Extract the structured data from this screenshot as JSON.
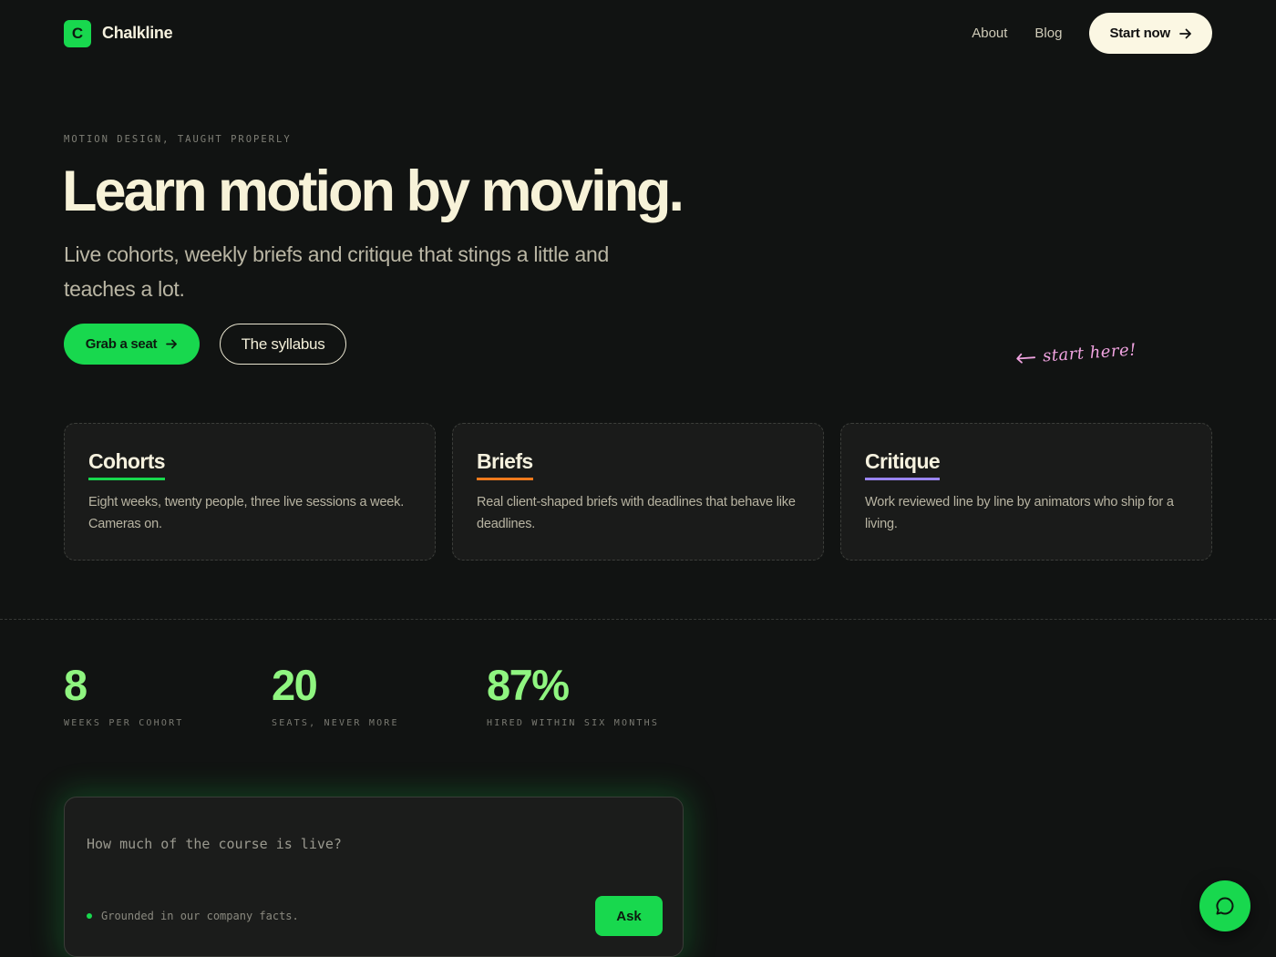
{
  "header": {
    "logo_letter": "C",
    "brand": "Chalkline",
    "nav": [
      {
        "label": "About"
      },
      {
        "label": "Blog"
      }
    ],
    "cta_label": "Start now"
  },
  "hero": {
    "eyebrow": "MOTION DESIGN, TAUGHT PROPERLY",
    "title": "Learn motion by moving.",
    "subtitle": "Live cohorts, weekly briefs and critique that stings a little and teaches a lot.",
    "primary_button": "Grab a seat",
    "secondary_button": "The syllabus",
    "annotation": "start here!"
  },
  "features": [
    {
      "title": "Cohorts",
      "body": "Eight weeks, twenty people, three live sessions a week. Cameras on.",
      "accent": "#18d84e"
    },
    {
      "title": "Briefs",
      "body": "Real client-shaped briefs with deadlines that behave like deadlines.",
      "accent": "#f07a1d"
    },
    {
      "title": "Critique",
      "body": "Work reviewed line by line by animators who ship for a living.",
      "accent": "#9a85f2"
    }
  ],
  "stats": [
    {
      "value": "8",
      "label": "WEEKS PER COHORT"
    },
    {
      "value": "20",
      "label": "SEATS, NEVER MORE"
    },
    {
      "value": "87%",
      "label": "HIRED WITHIN SIX MONTHS"
    }
  ],
  "ask": {
    "placeholder": "How much of the course is live?",
    "note": "Grounded in our company facts.",
    "button": "Ask"
  },
  "colors": {
    "background": "#111312",
    "accent_green": "#18d84e",
    "stat_green": "#8ff580",
    "annotation_pink": "#f0a3e0"
  },
  "icons": {
    "cta": "arrow-right-icon",
    "annotation": "arrow-left-icon",
    "chat": "chat-bubble-icon"
  }
}
